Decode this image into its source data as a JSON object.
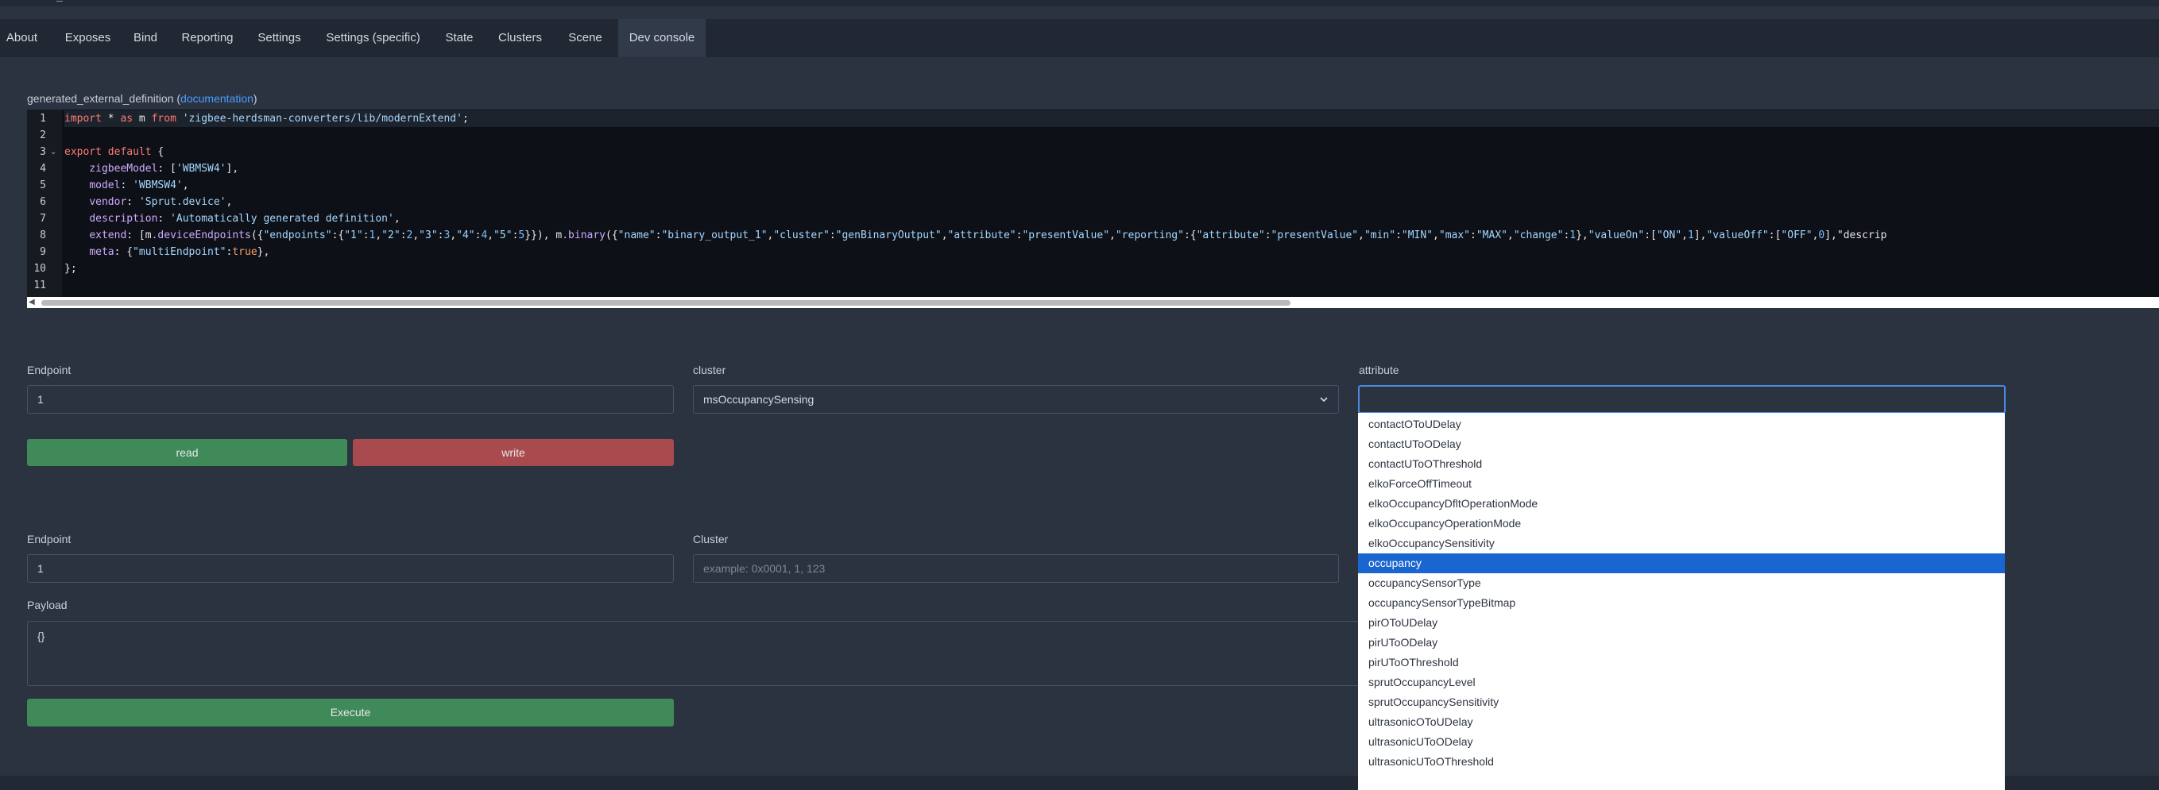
{
  "tabs": [
    {
      "label": "About",
      "name": "tab-about"
    },
    {
      "label": "Exposes",
      "name": "tab-exposes"
    },
    {
      "label": "Bind",
      "name": "tab-bind"
    },
    {
      "label": "Reporting",
      "name": "tab-reporting"
    },
    {
      "label": "Settings",
      "name": "tab-settings"
    },
    {
      "label": "Settings (specific)",
      "name": "tab-settings-specific"
    },
    {
      "label": "State",
      "name": "tab-state"
    },
    {
      "label": "Clusters",
      "name": "tab-clusters"
    },
    {
      "label": "Scene",
      "name": "tab-scene"
    },
    {
      "label": "Dev console",
      "name": "tab-dev-console"
    }
  ],
  "active_tab": "Dev console",
  "definition": {
    "label": "generated_external_definition",
    "paren_open": " (",
    "link_text": "documentation",
    "paren_close": ")"
  },
  "code": {
    "line_numbers": [
      "1",
      "2",
      "3",
      "4",
      "5",
      "6",
      "7",
      "8",
      "9",
      "10",
      "11"
    ],
    "lines": [
      "import * as m from 'zigbee-herdsman-converters/lib/modernExtend';",
      "",
      "export default {",
      "    zigbeeModel: ['WBMSW4'],",
      "    model: 'WBMSW4',",
      "    vendor: 'Sprut.device',",
      "    description: 'Automatically generated definition',",
      "    extend: [m.deviceEndpoints({\"endpoints\":{\"1\":1,\"2\":2,\"3\":3,\"4\":4,\"5\":5}}), m.binary({\"name\":\"binary_output_1\",\"cluster\":\"genBinaryOutput\",\"attribute\":\"presentValue\",\"reporting\":{\"attribute\":\"presentValue\",\"min\":\"MIN\",\"max\":\"MAX\",\"change\":1},\"valueOn\":[\"ON\",1],\"valueOff\":[\"OFF\",0],\"descrip",
      "    meta: {\"multiEndpoint\":true},",
      "};",
      ""
    ]
  },
  "read_write": {
    "endpoint_label": "Endpoint",
    "endpoint_value": "1",
    "cluster_label": "cluster",
    "cluster_value": "msOccupancySensing",
    "attribute_label": "attribute",
    "attribute_value": "",
    "read_label": "read",
    "write_label": "write"
  },
  "attribute_options": [
    "contactOToUDelay",
    "contactUToODelay",
    "contactUToOThreshold",
    "elkoForceOffTimeout",
    "elkoOccupancyDfltOperationMode",
    "elkoOccupancyOperationMode",
    "elkoOccupancySensitivity",
    "occupancy",
    "occupancySensorType",
    "occupancySensorTypeBitmap",
    "pirOToUDelay",
    "pirUToODelay",
    "pirUToOThreshold",
    "sprutOccupancyLevel",
    "sprutOccupancySensitivity",
    "ultrasonicOToUDelay",
    "ultrasonicUToODelay",
    "ultrasonicUToOThreshold"
  ],
  "highlighted_option": "occupancy",
  "command": {
    "endpoint_label": "Endpoint",
    "endpoint_value": "1",
    "cluster_label": "Cluster",
    "cluster_placeholder": "example: 0x0001, 1, 123",
    "payload_label": "Payload",
    "payload_value": "{}",
    "execute_label": "Execute"
  },
  "colors": {
    "accent_green": "#3f8a58",
    "accent_red": "#a94a4e",
    "selection_blue": "#1a66d1",
    "link_blue": "#4a9eff"
  }
}
